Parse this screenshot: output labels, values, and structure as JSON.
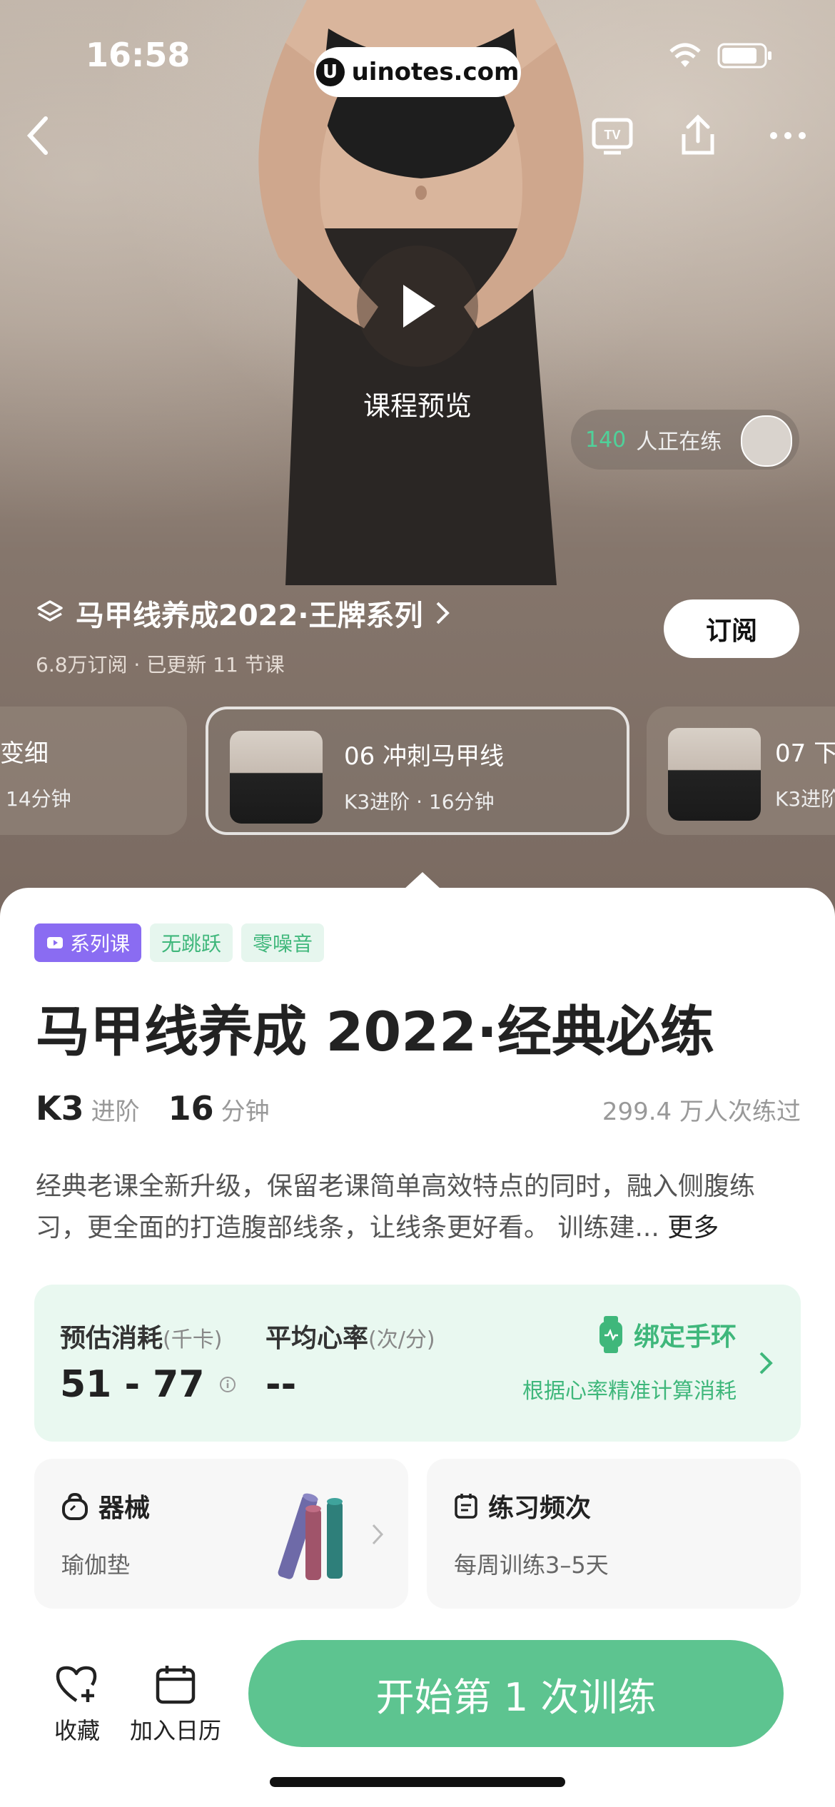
{
  "status_bar": {
    "time": "16:58",
    "url": "uinotes.com"
  },
  "hero": {
    "preview_label": "课程预览",
    "practicing_count": "140",
    "practicing_text": "人正在练"
  },
  "series": {
    "title": "马甲线养成2022·王牌系列",
    "subtitle": "6.8万订阅 · 已更新 11 节课",
    "subscribe_label": "订阅"
  },
  "lesson_cards": [
    {
      "title": "变细",
      "sub": "14分钟"
    },
    {
      "title": "06 冲刺马甲线",
      "sub": "K3进阶 · 16分钟"
    },
    {
      "title": "07 下",
      "sub": "K3进阶"
    }
  ],
  "tags": [
    "系列课",
    "无跳跃",
    "零噪音"
  ],
  "course": {
    "title": "马甲线养成 2022·经典必练",
    "level_code": "K3",
    "level_name": "进阶",
    "duration_value": "16",
    "duration_unit": "分钟",
    "practiced": "299.4 万人次练过",
    "description": "经典老课全新升级，保留老课简单高效特点的同时，融入侧腹练习，更全面的打造腹部线条，让线条更好看。 训练建...",
    "more_label": "更多"
  },
  "stats": {
    "calories_label": "预估消耗",
    "calories_unit": "(千卡)",
    "calories_value": "51 - 77",
    "heart_label": "平均心率",
    "heart_unit": "(次/分)",
    "heart_value": "--",
    "bind_label": "绑定手环",
    "bind_sub": "根据心率精准计算消耗"
  },
  "equipment": {
    "title": "器械",
    "value": "瑜伽垫"
  },
  "frequency": {
    "title": "练习频次",
    "value": "每周训练3–5天"
  },
  "bottom": {
    "favorite_label": "收藏",
    "calendar_label": "加入日历",
    "start_label": "开始第 1 次训练"
  },
  "colors": {
    "accent_green": "#5dc490",
    "series_tag": "#8a6cf2",
    "stats_bg": "#e9f8f0"
  }
}
